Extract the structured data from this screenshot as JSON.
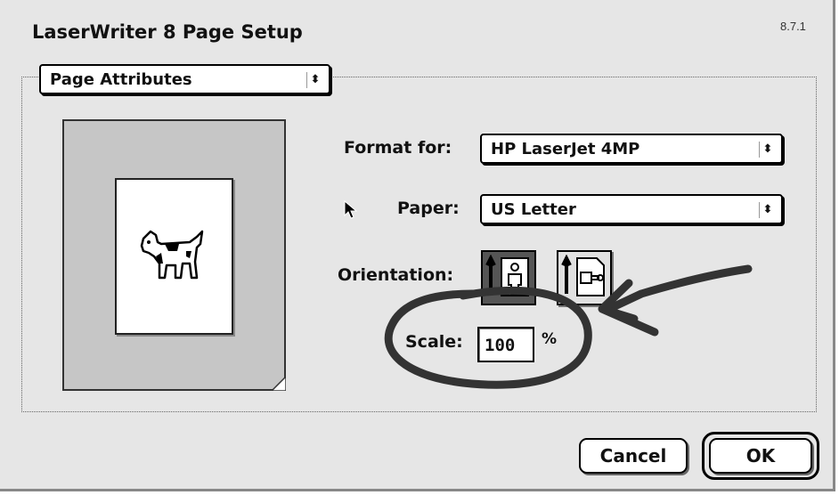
{
  "dialog": {
    "title": "LaserWriter 8 Page Setup",
    "version": "8.7.1"
  },
  "section_popup": {
    "value": "Page Attributes"
  },
  "format": {
    "label": "Format for:",
    "value": "HP LaserJet 4MP"
  },
  "paper": {
    "label": "Paper:",
    "value": "US Letter"
  },
  "orientation": {
    "label": "Orientation:",
    "selected": "portrait"
  },
  "scale": {
    "label": "Scale:",
    "value": "100",
    "unit": "%"
  },
  "buttons": {
    "cancel": "Cancel",
    "ok": "OK"
  },
  "icons": {
    "popup_arrow": "⬍",
    "preview_image": "dogcow-icon",
    "portrait": "portrait-orientation-icon",
    "landscape": "landscape-orientation-icon",
    "cursor": "arrow-cursor-icon"
  },
  "colors": {
    "dialog_bg": "#e6e6e6",
    "preview_bg": "#c6c6c6",
    "selected_button": "#555555",
    "annotation_ink": "#333333"
  }
}
